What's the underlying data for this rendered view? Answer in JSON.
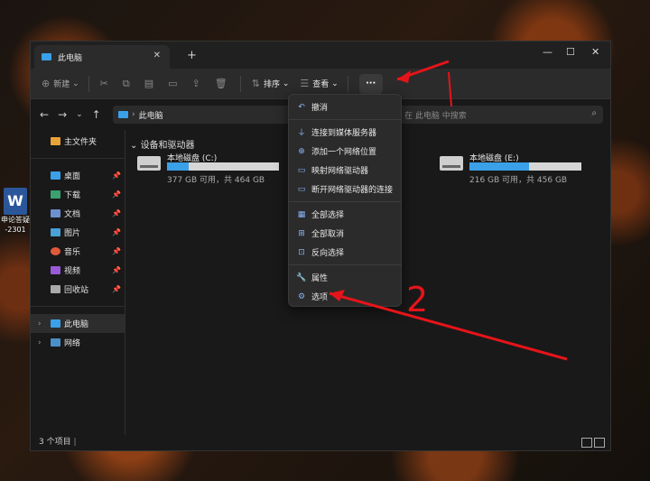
{
  "desktop": {
    "icon_label_line1": "申论答疑",
    "icon_label_line2": "-2301",
    "icon_letter": "W"
  },
  "window": {
    "tab_title": "此电脑",
    "toolbar": {
      "new_label": "新建",
      "sort_label": "排序",
      "view_label": "查看",
      "more_label": "···"
    },
    "address": {
      "path": "此电脑"
    },
    "search": {
      "placeholder": "在 此电脑 中搜索"
    },
    "sidebar": {
      "quick": [
        {
          "label": "主文件夹",
          "color": "#e8a23a"
        },
        {
          "label": "桌面",
          "color": "#3aa0e8",
          "pinned": true
        },
        {
          "label": "下载",
          "color": "#3aa070",
          "pinned": true
        },
        {
          "label": "文档",
          "color": "#6e8fcf",
          "pinned": true
        },
        {
          "label": "图片",
          "color": "#4aa0d8",
          "pinned": true
        },
        {
          "label": "音乐",
          "color": "#e05a3a",
          "pinned": true
        },
        {
          "label": "视频",
          "color": "#9a5ad8",
          "pinned": true
        },
        {
          "label": "回收站",
          "color": "#aaaaaa",
          "pinned": true
        }
      ],
      "this_pc": "此电脑",
      "network": "网络"
    },
    "main": {
      "section_title": "设备和驱动器",
      "drives": [
        {
          "name": "本地磁盘 (C:)",
          "size": "377 GB 可用，共 464 GB",
          "used_fraction": 0.19
        },
        {
          "name": "本地磁盘 (E:)",
          "size": "216 GB 可用，共 456 GB",
          "used_fraction": 0.53
        }
      ]
    },
    "status": {
      "count": "3 个项目"
    }
  },
  "menu": {
    "items": [
      {
        "label": "撤消",
        "icon": "undo-icon"
      },
      {
        "label": "连接到媒体服务器",
        "icon": "media-server-icon"
      },
      {
        "label": "添加一个网络位置",
        "icon": "network-location-icon"
      },
      {
        "label": "映射网络驱动器",
        "icon": "map-drive-icon"
      },
      {
        "label": "断开网络驱动器的连接",
        "icon": "disconnect-drive-icon"
      },
      {
        "label": "全部选择",
        "icon": "select-all-icon"
      },
      {
        "label": "全部取消",
        "icon": "select-none-icon"
      },
      {
        "label": "反向选择",
        "icon": "invert-selection-icon"
      },
      {
        "label": "属性",
        "icon": "properties-icon"
      },
      {
        "label": "选项",
        "icon": "options-icon"
      }
    ]
  },
  "annotation": {
    "mark": "2"
  }
}
